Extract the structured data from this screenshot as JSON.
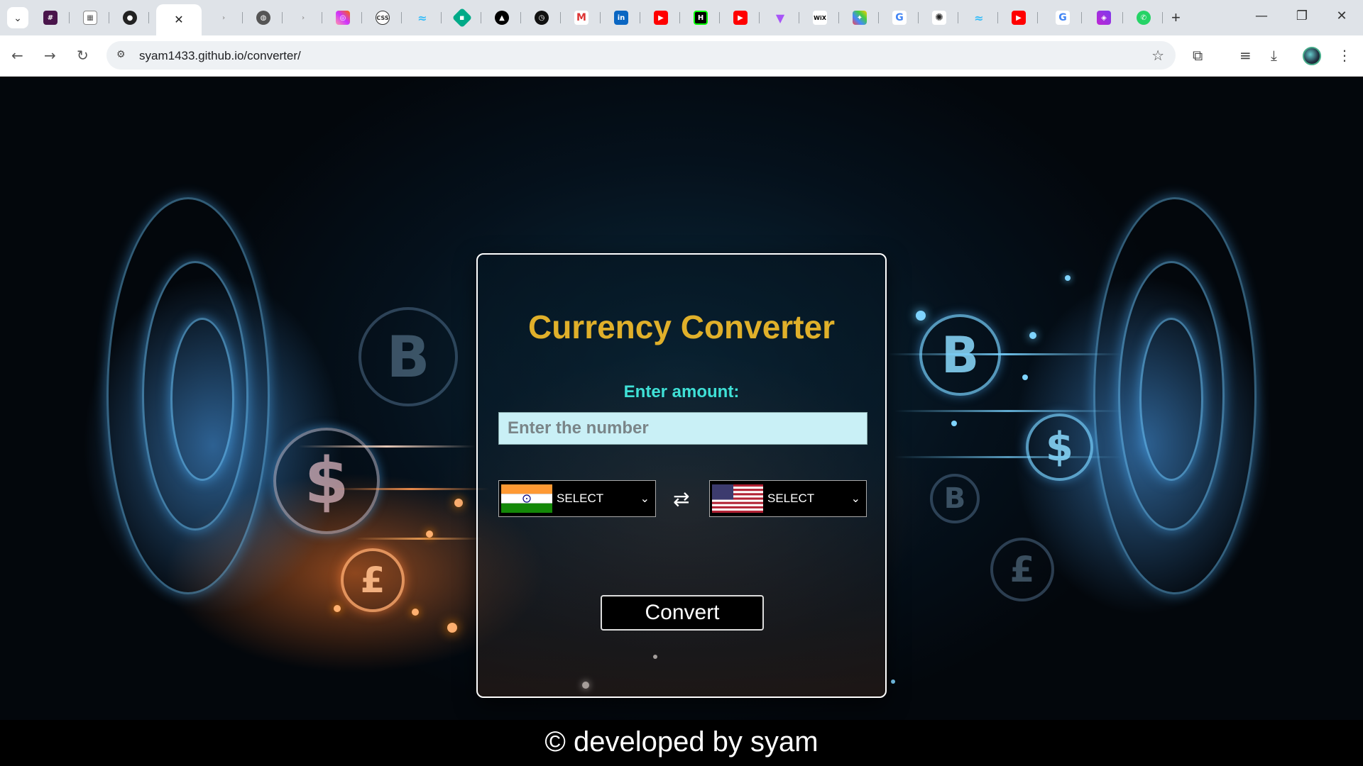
{
  "browser": {
    "tabs": [
      "slack",
      "figma",
      "github",
      "active",
      "blank",
      "globe",
      "blank2",
      "instagram",
      "css",
      "tailwind",
      "feather",
      "triangle",
      "clock",
      "gmail",
      "linkedin",
      "youtube",
      "hackernoon",
      "youtube2",
      "vite",
      "wix",
      "puzzle",
      "google",
      "openai",
      "tailwind2",
      "youtube3",
      "google2",
      "shield",
      "whatsapp"
    ],
    "url": "syam1433.github.io/converter/"
  },
  "converter": {
    "title": "Currency Converter",
    "amount_label": "Enter amount:",
    "amount_placeholder": "Enter the number",
    "from": {
      "label": "SELECT",
      "flag": "india-flag"
    },
    "to": {
      "label": "SELECT",
      "flag": "usa-flag"
    },
    "swap_icon": "⇄",
    "convert_label": "Convert"
  },
  "footer": {
    "text": "© developed by syam"
  }
}
